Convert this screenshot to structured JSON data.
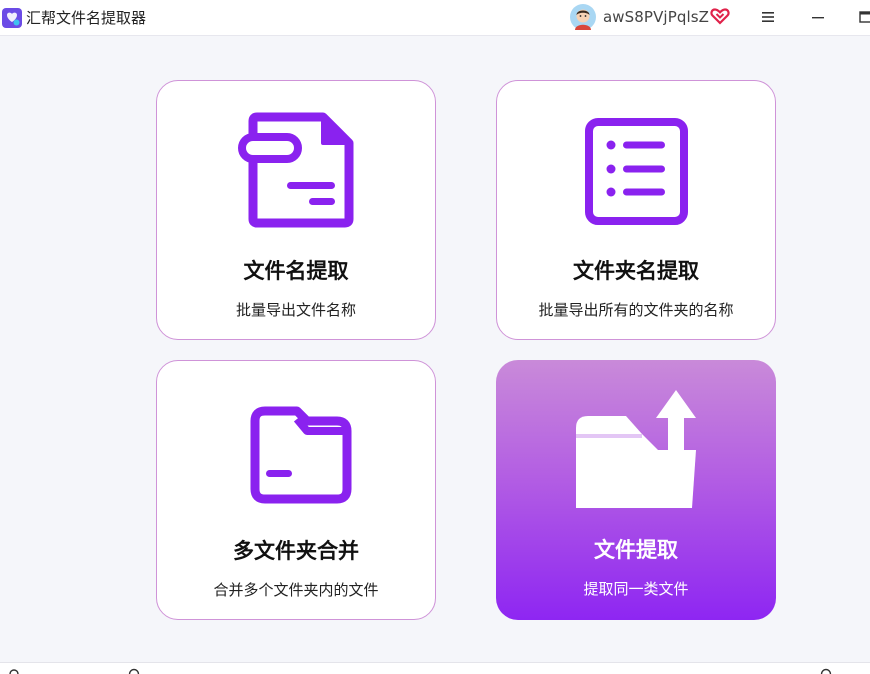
{
  "app": {
    "title": "汇帮文件名提取器",
    "logo_icon": "app-logo-icon"
  },
  "user": {
    "name": "awS8PVjPqlsZ",
    "avatar_icon": "avatar-icon",
    "badge_icon": "vip-heart-icon"
  },
  "window_controls": {
    "menu_icon": "hamburger-menu-icon",
    "minimize_icon": "minimize-icon",
    "maximize_icon": "maximize-icon"
  },
  "cards": [
    {
      "title": "文件名提取",
      "subtitle": "批量导出文件名称",
      "icon": "file-document-icon",
      "active": false
    },
    {
      "title": "文件夹名提取",
      "subtitle": "批量导出所有的文件夹的名称",
      "icon": "list-document-icon",
      "active": false
    },
    {
      "title": "多文件夹合并",
      "subtitle": "合并多个文件夹内的文件",
      "icon": "folder-icon",
      "active": false
    },
    {
      "title": "文件提取",
      "subtitle": "提取同一类文件",
      "icon": "folder-upload-icon",
      "active": true
    }
  ],
  "colors": {
    "accent": "#8e26f2",
    "card_border": "#cf93d8",
    "icon_purple": "#8a22ef",
    "vip_red": "#e0224a"
  }
}
